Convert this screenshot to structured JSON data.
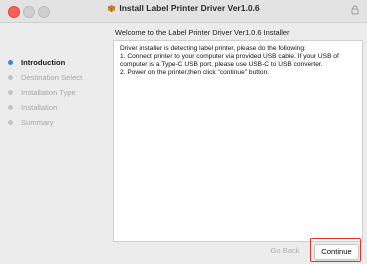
{
  "window": {
    "title": "Install Label Printer Driver Ver1.0.6"
  },
  "main": {
    "welcome": "Welcome to the Label Printer Driver Ver1.0.6 Installer",
    "lines": [
      "Driver installer is detecting label printer, please do the following:",
      "1. Connect printer to your computer via provided USB cable. If your USB of computer is a Type-C USB port, please use USB-C to USB converter.",
      "2. Power on the printer,then click \"continue\" button."
    ]
  },
  "sidebar": {
    "steps": [
      {
        "label": "Introduction",
        "active": true
      },
      {
        "label": "Destination Select",
        "active": false
      },
      {
        "label": "Installation Type",
        "active": false
      },
      {
        "label": "Installation",
        "active": false
      },
      {
        "label": "Summary",
        "active": false
      }
    ]
  },
  "buttons": {
    "back": "Go Back",
    "continue": "Continue"
  },
  "colors": {
    "active_dot": "#3a7ff4",
    "highlight": "#e8302a",
    "close": "#fe5f57"
  },
  "icons": {
    "title": "package-icon",
    "lock": "lock-icon"
  }
}
